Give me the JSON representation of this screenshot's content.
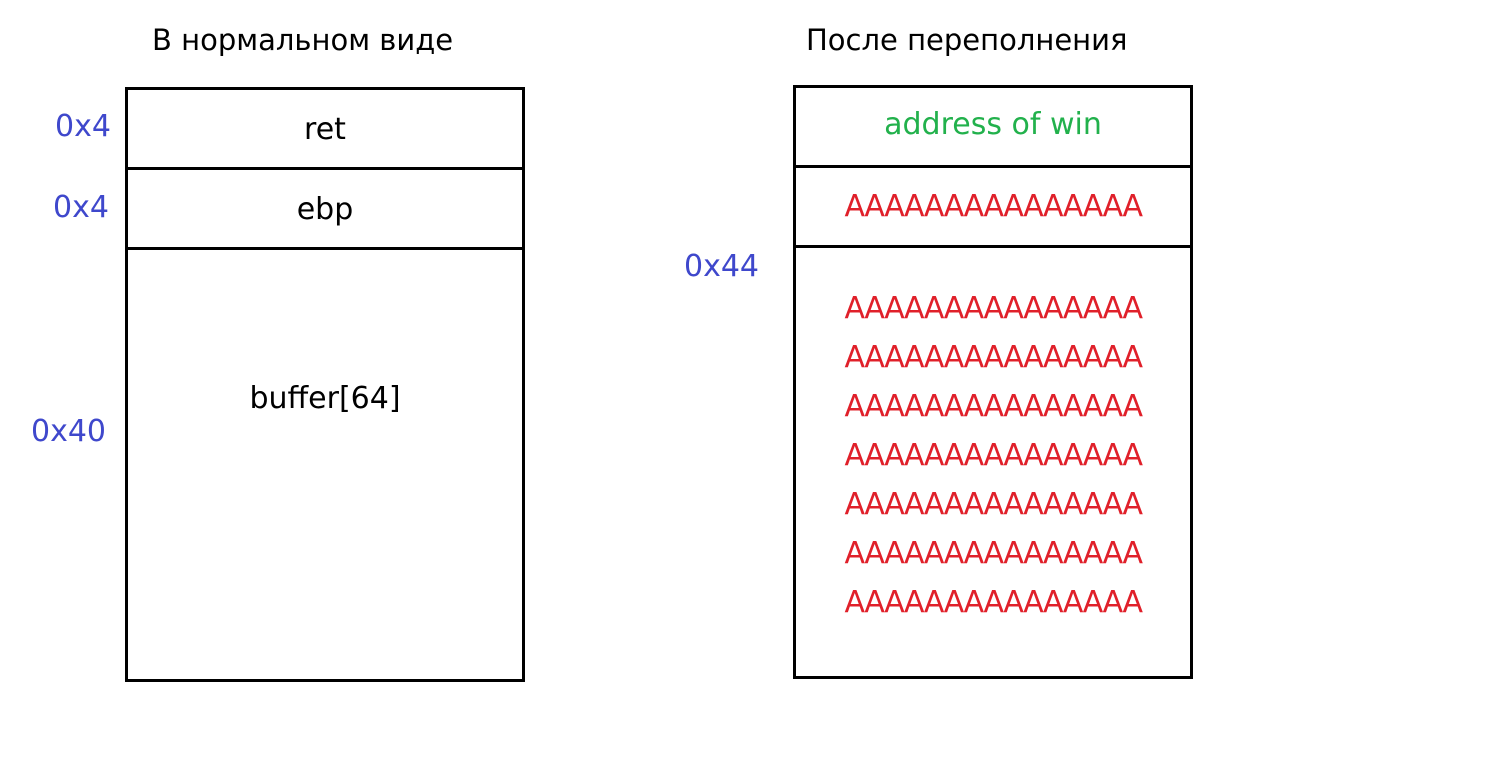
{
  "colors": {
    "size_label": "#3f48cc",
    "overflow_fill": "#e0202a",
    "ret_overwrite": "#22b14c",
    "text": "#000000",
    "border": "#000000"
  },
  "normal": {
    "title": "В нормальном виде",
    "cells": {
      "ret": "ret",
      "ebp": "ebp",
      "buffer": "buffer[64]"
    },
    "sizes": {
      "ret": "0x4",
      "ebp": "0x4",
      "buffer": "0x40"
    }
  },
  "overflow": {
    "title": "После переполнения",
    "ret_value": "address of win",
    "ebp_value": "AAAAAAAAAAAAAAA",
    "size": "0x44",
    "buffer_lines": [
      "AAAAAAAAAAAAAAA",
      "AAAAAAAAAAAAAAA",
      "AAAAAAAAAAAAAAA",
      "AAAAAAAAAAAAAAA",
      "AAAAAAAAAAAAAAA",
      "AAAAAAAAAAAAAAA",
      "AAAAAAAAAAAAAAA"
    ]
  }
}
